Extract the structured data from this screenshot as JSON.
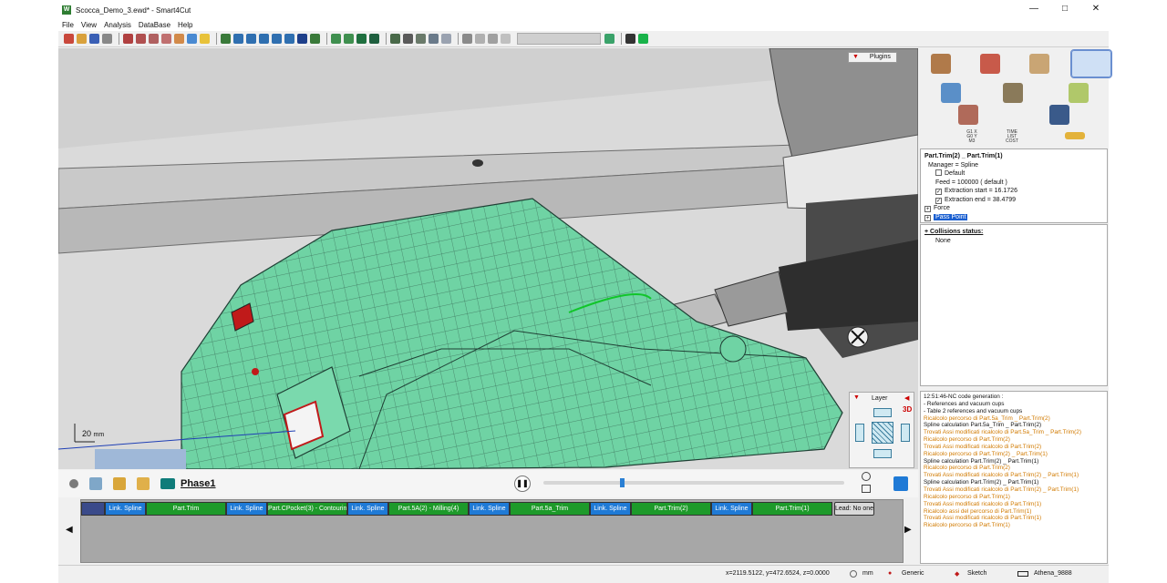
{
  "window": {
    "title": "Scocca_Demo_3.ewd* - Smart4Cut",
    "app_icon": "smart4cut-logo-icon",
    "minimize": "—",
    "maximize": "□",
    "close": "✕"
  },
  "menu": [
    "File",
    "View",
    "Analysis",
    "DataBase",
    "Help"
  ],
  "viewport": {
    "plugins_label": "Plugins",
    "layer_label": "Layer",
    "view_mode": "3D",
    "scale_value": "20",
    "scale_unit": "mm"
  },
  "phase": {
    "name": "Phase1"
  },
  "timeline": {
    "segments": [
      {
        "kind": "link",
        "label": "Link. Spline"
      },
      {
        "kind": "part",
        "label": "Part.Trim"
      },
      {
        "kind": "link",
        "label": "Link. Spline"
      },
      {
        "kind": "part",
        "label": "Part.CPocket(3) - Contouring..."
      },
      {
        "kind": "link",
        "label": "Link. Spline"
      },
      {
        "kind": "part",
        "label": "Part.5A(2) - Milling(4)"
      },
      {
        "kind": "link",
        "label": "Link. Spline"
      },
      {
        "kind": "part",
        "label": "Part.5a_Trim"
      },
      {
        "kind": "link",
        "label": "Link. Spline"
      },
      {
        "kind": "part",
        "label": "Part.Trim(2)"
      },
      {
        "kind": "link",
        "label": "Link. Spline"
      },
      {
        "kind": "part",
        "label": "Part.Trim(1)"
      },
      {
        "kind": "lead",
        "label": "Lead: No one"
      }
    ]
  },
  "properties": {
    "header": "Part.Trim(2) _ Part.Trim(1)",
    "manager": "Manager = Spline",
    "default_label": "Default",
    "feed": "Feed = 100000 ( default )",
    "extraction_start": "Extraction start = 16.1726",
    "extraction_end": "Extraction end = 38.4799",
    "force": "Force",
    "pass_point": "Pass Point"
  },
  "collisions": {
    "title": "+ Collisions status:",
    "value": "None"
  },
  "log": [
    {
      "c": "b",
      "t": "12:51:46-NC code generation :"
    },
    {
      "c": "b",
      "t": "- References and vacuum cups"
    },
    {
      "c": "b",
      "t": "- Table 2 references and vacuum cups"
    },
    {
      "c": "o",
      "t": "Ricalcolo percorso di Part.5a_Trim _ Part.Trim(2)"
    },
    {
      "c": "b",
      "t": "Spline calculation Part.5a_Trim _ Part.Trim(2)"
    },
    {
      "c": "o",
      "t": "Trovati Assi modificati ricalcolo di Part.5a_Trim _ Part.Trim(2)"
    },
    {
      "c": "o",
      "t": "Ricalcolo percorso di Part.Trim(2)"
    },
    {
      "c": "o",
      "t": "Trovati Assi modificati ricalcolo di Part.Trim(2)"
    },
    {
      "c": "o",
      "t": "Ricalcolo percorso di Part.Trim(2) _ Part.Trim(1)"
    },
    {
      "c": "b",
      "t": "Spline calculation Part.Trim(2) _ Part.Trim(1)"
    },
    {
      "c": "o",
      "t": "Ricalcolo percorso di Part.Trim(2)"
    },
    {
      "c": "o",
      "t": "Trovati Assi modificati ricalcolo di Part.Trim(2) _ Part.Trim(1)"
    },
    {
      "c": "b",
      "t": "Spline calculation Part.Trim(2) _ Part.Trim(1)"
    },
    {
      "c": "o",
      "t": "Trovati Assi modificati ricalcolo di Part.Trim(2) _ Part.Trim(1)"
    },
    {
      "c": "o",
      "t": "Ricalcolo percorso di Part.Trim(1)"
    },
    {
      "c": "o",
      "t": "Trovati Assi modificati ricalcolo di Part.Trim(1)"
    },
    {
      "c": "o",
      "t": "Ricalcolo assi del percorso di Part.Trim(1)"
    },
    {
      "c": "o",
      "t": "Trovati Assi modificati ricalcolo di Part.Trim(1)"
    },
    {
      "c": "o",
      "t": "Ricalcolo percorso di Part.Trim(1)"
    }
  ],
  "status": {
    "coords": "x=2119.5122, y=472.6524, z=0.0000",
    "unit": "mm",
    "mode": "Generic",
    "sketch": "Sketch",
    "machine": "Athena_9888"
  },
  "colors": {
    "part_segment": "#1d9a2a",
    "link_segment": "#1f7ad6",
    "log_warning": "#d17a00",
    "selection": "#1a5fd0"
  }
}
